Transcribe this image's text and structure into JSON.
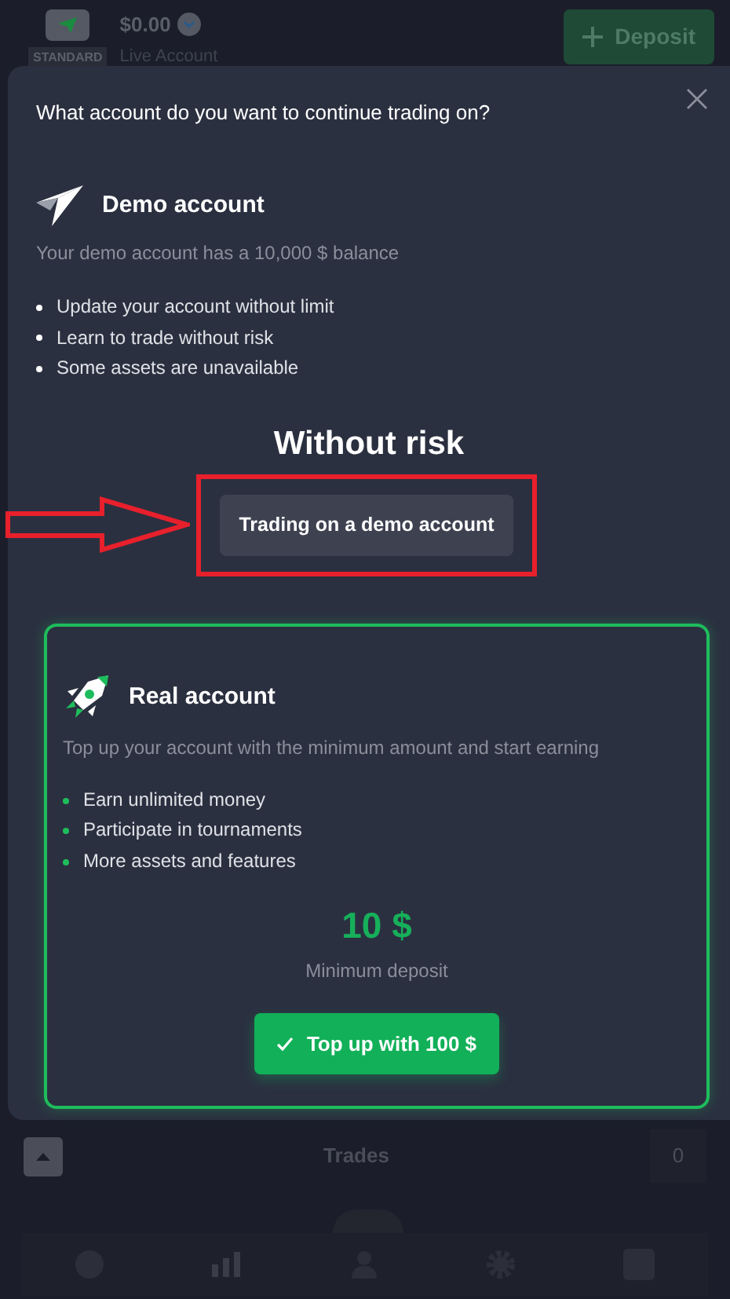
{
  "top_bar": {
    "account_type": "STANDARD",
    "balance": "$0.00",
    "account_name": "Live Account",
    "deposit_button": "Deposit"
  },
  "modal": {
    "question": "What account do you want to continue trading on?",
    "demo": {
      "title": "Demo account",
      "subtitle": "Your demo account has a 10,000 $ balance",
      "features": [
        "Update your account without limit",
        "Learn to trade without risk",
        "Some assets are unavailable"
      ],
      "heading": "Without risk",
      "button": "Trading on a demo account"
    },
    "real": {
      "title": "Real account",
      "subtitle": "Top up your account with the minimum amount and start earning",
      "features": [
        "Earn unlimited money",
        "Participate in tournaments",
        "More assets and features"
      ],
      "amount": "10 $",
      "amount_caption": "Minimum deposit",
      "button": "Top up with 100 $"
    }
  },
  "trades_bar": {
    "label": "Trades",
    "count": "0"
  }
}
